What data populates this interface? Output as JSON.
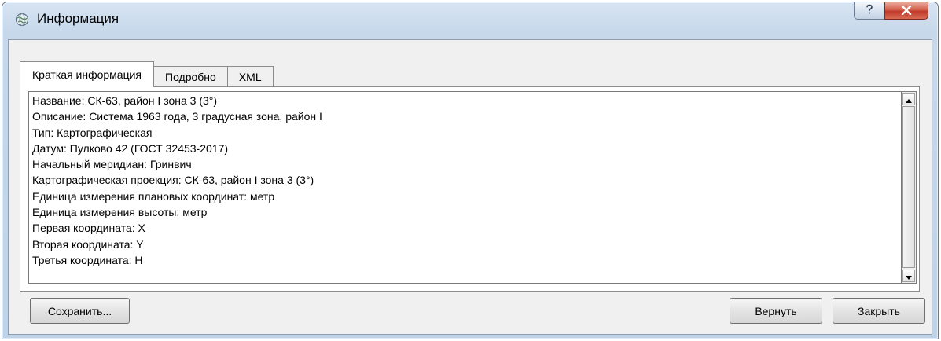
{
  "window": {
    "title": "Информация"
  },
  "tabs": [
    {
      "label": "Краткая информация",
      "active": true
    },
    {
      "label": "Подробно",
      "active": false
    },
    {
      "label": "XML",
      "active": false
    }
  ],
  "info_lines": [
    "Название: СК-63, район I зона 3 (3°)",
    "Описание: Система 1963 года, 3 градусная зона, район I",
    "Тип: Картографическая",
    "Датум: Пулково 42 (ГОСТ 32453-2017)",
    "Начальный меридиан: Гринвич",
    "Картографическая проекция: СК-63, район I зона 3 (3°)",
    "Единица измерения плановых координат: метр",
    "Единица измерения высоты: метр",
    "Первая координата: X",
    "Вторая координата: Y",
    "Третья координата: H"
  ],
  "buttons": {
    "save": "Сохранить...",
    "revert": "Вернуть",
    "close": "Закрыть"
  },
  "icons": {
    "app": "globe-icon",
    "help": "question-mark-icon",
    "close": "x-icon",
    "scroll_up": "triangle-up-icon",
    "scroll_down": "triangle-down-icon"
  }
}
